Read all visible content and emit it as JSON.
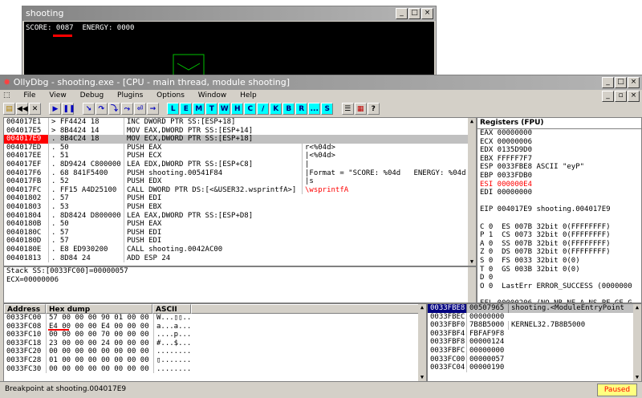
{
  "game": {
    "title": "shooting",
    "hud": "SCORE: 0087  ENERGY: 0000"
  },
  "ollydbg": {
    "title": "OllyDbg - shooting.exe - [CPU - main thread, module shooting]",
    "menu": [
      "File",
      "View",
      "Debug",
      "Plugins",
      "Options",
      "Window",
      "Help"
    ],
    "toolbar_letters": [
      "L",
      "E",
      "M",
      "T",
      "W",
      "H",
      "C",
      "/",
      "K",
      "B",
      "R",
      "...",
      "S"
    ],
    "disasm_rows": [
      {
        "addr": "004017E1",
        "bytes": "> FF4424 18",
        "instr": "INC DWORD PTR SS:[ESP+18]",
        "comment": ""
      },
      {
        "addr": "004017E5",
        "bytes": "> 8B4424 14",
        "instr": "MOV EAX,DWORD PTR SS:[ESP+14]",
        "comment": ""
      },
      {
        "addr": "004017E9",
        "bytes": ". 8B4C24 18",
        "instr": "MOV ECX,DWORD PTR SS:[ESP+18]",
        "comment": ""
      },
      {
        "addr": "004017ED",
        "bytes": ". 50",
        "instr": "PUSH EAX",
        "comment": "r<%04d>"
      },
      {
        "addr": "004017EE",
        "bytes": ". 51",
        "instr": "PUSH ECX",
        "comment": "|<%04d>"
      },
      {
        "addr": "004017EF",
        "bytes": ". 8D9424 C800000",
        "instr": "LEA EDX,DWORD PTR SS:[ESP+C8]",
        "comment": "|"
      },
      {
        "addr": "004017F6",
        "bytes": ". 68 841F5400",
        "instr": "PUSH shooting.00541F84",
        "comment": "|Format = \"SCORE: %04d   ENERGY: %04d"
      },
      {
        "addr": "004017FB",
        "bytes": ". 52",
        "instr": "PUSH EDX",
        "comment": "|s"
      },
      {
        "addr": "004017FC",
        "bytes": ". FF15 A4D25100",
        "instr": "CALL DWORD PTR DS:[<&USER32.wsprintfA>]",
        "comment": "\\wsprintfA"
      },
      {
        "addr": "00401802",
        "bytes": ". 57",
        "instr": "PUSH EDI",
        "comment": ""
      },
      {
        "addr": "00401803",
        "bytes": ". 53",
        "instr": "PUSH EBX",
        "comment": ""
      },
      {
        "addr": "00401804",
        "bytes": ". 8D8424 D800000",
        "instr": "LEA EAX,DWORD PTR SS:[ESP+D8]",
        "comment": ""
      },
      {
        "addr": "0040180B",
        "bytes": ". 50",
        "instr": "PUSH EAX",
        "comment": ""
      },
      {
        "addr": "0040180C",
        "bytes": ". 57",
        "instr": "PUSH EDI",
        "comment": ""
      },
      {
        "addr": "0040180D",
        "bytes": ". 57",
        "instr": "PUSH EDI",
        "comment": ""
      },
      {
        "addr": "0040180E",
        "bytes": ". E8 ED930200",
        "instr": "CALL shooting.0042AC00",
        "comment": ""
      },
      {
        "addr": "00401813",
        "bytes": ". 8D84 24",
        "instr": "ADD ESP 24",
        "comment": ""
      }
    ],
    "info_lines": [
      "Stack SS:[0033FC00]=00000057",
      "ECX=00000006"
    ],
    "registers_header": "Registers (FPU)",
    "registers": [
      {
        "text": "EAX 00000000",
        "red": false
      },
      {
        "text": "ECX 00000006",
        "red": false
      },
      {
        "text": "EDX 0135D9D0",
        "red": false
      },
      {
        "text": "EBX FFFFF7F7",
        "red": false
      },
      {
        "text": "ESP 0033FBE8 ASCII \"eyP\"",
        "red": false
      },
      {
        "text": "EBP 0033FDB0",
        "red": false
      },
      {
        "text": "ESI 000000E4",
        "red": true
      },
      {
        "text": "EDI 00000000",
        "red": false
      },
      {
        "text": "",
        "red": false
      },
      {
        "text": "EIP 004017E9 shooting.004017E9",
        "red": false
      },
      {
        "text": "",
        "red": false
      },
      {
        "text": "C 0  ES 007B 32bit 0(FFFFFFFF)",
        "red": false
      },
      {
        "text": "P 1  CS 0073 32bit 0(FFFFFFFF)",
        "red": false
      },
      {
        "text": "A 0  SS 007B 32bit 0(FFFFFFFF)",
        "red": false
      },
      {
        "text": "Z 0  DS 007B 32bit 0(FFFFFFFF)",
        "red": false
      },
      {
        "text": "S 0  FS 0033 32bit 0(0)",
        "red": false
      },
      {
        "text": "T 0  GS 003B 32bit 0(0)",
        "red": false
      },
      {
        "text": "D 0",
        "red": false
      },
      {
        "text": "O 0  LastErr ERROR_SUCCESS (0000000",
        "red": false
      },
      {
        "text": "",
        "red": false
      },
      {
        "text": "EFL 00000206 (NO,NB,NE,A,NS,PE,GE,G",
        "red": false
      }
    ],
    "dump_headers": {
      "address": "Address",
      "hex": "Hex dump",
      "ascii": "ASCII"
    },
    "dump_rows": [
      {
        "addr": "0033FC00",
        "hex": "57 00 00 00 90 01 00 00",
        "ascii": "W...▯▯.."
      },
      {
        "addr": "0033FC08",
        "hex": "E4 00 00 00 E4 00 00 00",
        "ascii": "a...a..."
      },
      {
        "addr": "0033FC10",
        "hex": "00 00 00 00 70 00 00 00",
        "ascii": "....p..."
      },
      {
        "addr": "0033FC18",
        "hex": "23 00 00 00 24 00 00 00",
        "ascii": "#...$..."
      },
      {
        "addr": "0033FC20",
        "hex": "00 00 00 00 00 00 00 00",
        "ascii": "........"
      },
      {
        "addr": "0033FC28",
        "hex": "01 00 00 00 00 00 00 00",
        "ascii": "▯......."
      },
      {
        "addr": "0033FC30",
        "hex": "00 00 00 00 00 00 00 00",
        "ascii": "........"
      }
    ],
    "stack_header": {
      "addr": "0033FBE8",
      "val": "00507965",
      "comment": "shooting.<ModuleEntryPoint"
    },
    "stack_rows": [
      {
        "addr": "0033FBEC",
        "val": "00000000",
        "comment": ""
      },
      {
        "addr": "0033FBF0",
        "val": "7B8B5000",
        "comment": "KERNEL32.7B8B5000"
      },
      {
        "addr": "0033FBF4",
        "val": "FBFAF9F8",
        "comment": ""
      },
      {
        "addr": "0033FBF8",
        "val": "00000124",
        "comment": ""
      },
      {
        "addr": "0033FBFC",
        "val": "00000000",
        "comment": ""
      },
      {
        "addr": "0033FC00",
        "val": "00000057",
        "comment": ""
      },
      {
        "addr": "0033FC04",
        "val": "00000190",
        "comment": ""
      }
    ],
    "status": "Breakpoint at shooting.004017E9",
    "state": "Paused"
  },
  "colors": {
    "accent": "#ff0000",
    "paused_bg": "#ffff80",
    "toolbar_letter_bg": "#00ffff"
  }
}
